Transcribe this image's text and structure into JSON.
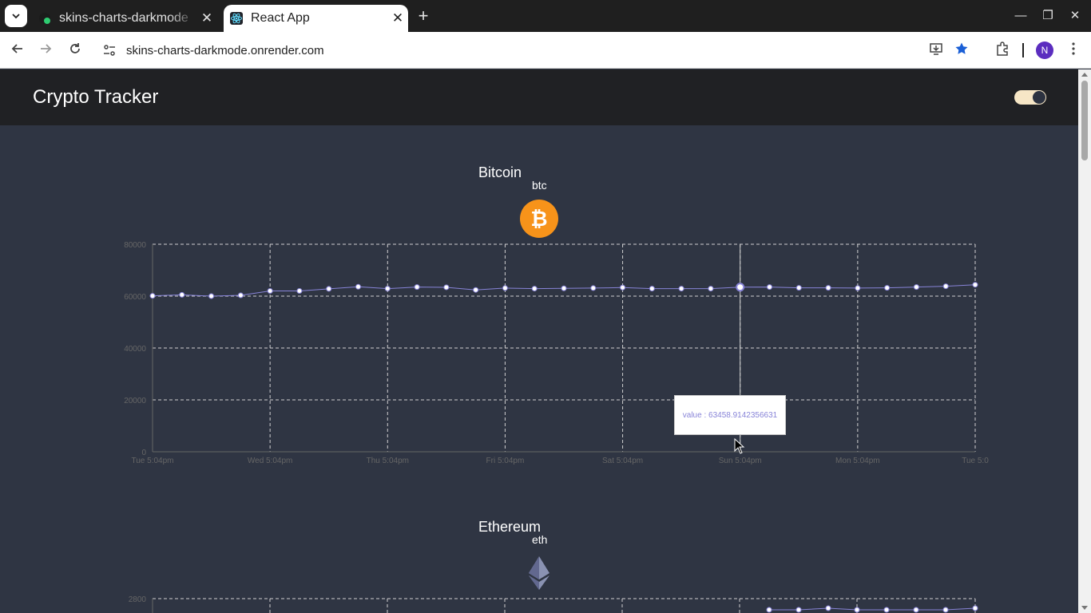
{
  "browser": {
    "tabs": [
      {
        "title": "skins-charts-darkmode",
        "active": false
      },
      {
        "title": "React App",
        "active": true
      }
    ],
    "url": "skins-charts-darkmode.onrender.com",
    "profile_initial": "N"
  },
  "app": {
    "title": "Crypto Tracker",
    "theme_toggle": "dark"
  },
  "coins": [
    {
      "name": "Bitcoin",
      "symbol": "btc",
      "icon": "bitcoin-icon"
    },
    {
      "name": "Ethereum",
      "symbol": "eth",
      "icon": "ethereum-icon"
    }
  ],
  "tooltip": {
    "text": "value : 63458.9142356631"
  },
  "chart_data": [
    {
      "type": "line",
      "series_color": "#8884d8",
      "x": [
        "Tue 5:04pm",
        "",
        "",
        "",
        "Wed 5:04pm",
        "",
        "",
        "",
        "Thu 5:04pm",
        "",
        "",
        "",
        "Fri 5:04pm",
        "",
        "",
        "",
        "Sat 5:04pm",
        "",
        "",
        "",
        "Sun 5:04pm",
        "",
        "",
        "",
        "Mon 5:04pm",
        "",
        "",
        "",
        "Tue 5:04pm"
      ],
      "x_ticks": [
        "Tue 5:04pm",
        "Wed 5:04pm",
        "Thu 5:04pm",
        "Fri 5:04pm",
        "Sat 5:04pm",
        "Sun 5:04pm",
        "Mon 5:04pm",
        "Tue 5:0"
      ],
      "values": [
        60100,
        60500,
        60000,
        60300,
        62000,
        62000,
        62800,
        63600,
        62900,
        63500,
        63400,
        62400,
        63100,
        62900,
        63000,
        63100,
        63300,
        62900,
        62900,
        62900,
        63459,
        63500,
        63200,
        63200,
        63100,
        63200,
        63500,
        63800,
        64400
      ],
      "y_ticks": [
        0,
        20000,
        40000,
        60000,
        80000
      ],
      "ylim": [
        0,
        80000
      ],
      "grid": true
    },
    {
      "type": "line",
      "series_color": "#8884d8",
      "y_ticks_visible": [
        2800
      ],
      "grid": true
    }
  ]
}
